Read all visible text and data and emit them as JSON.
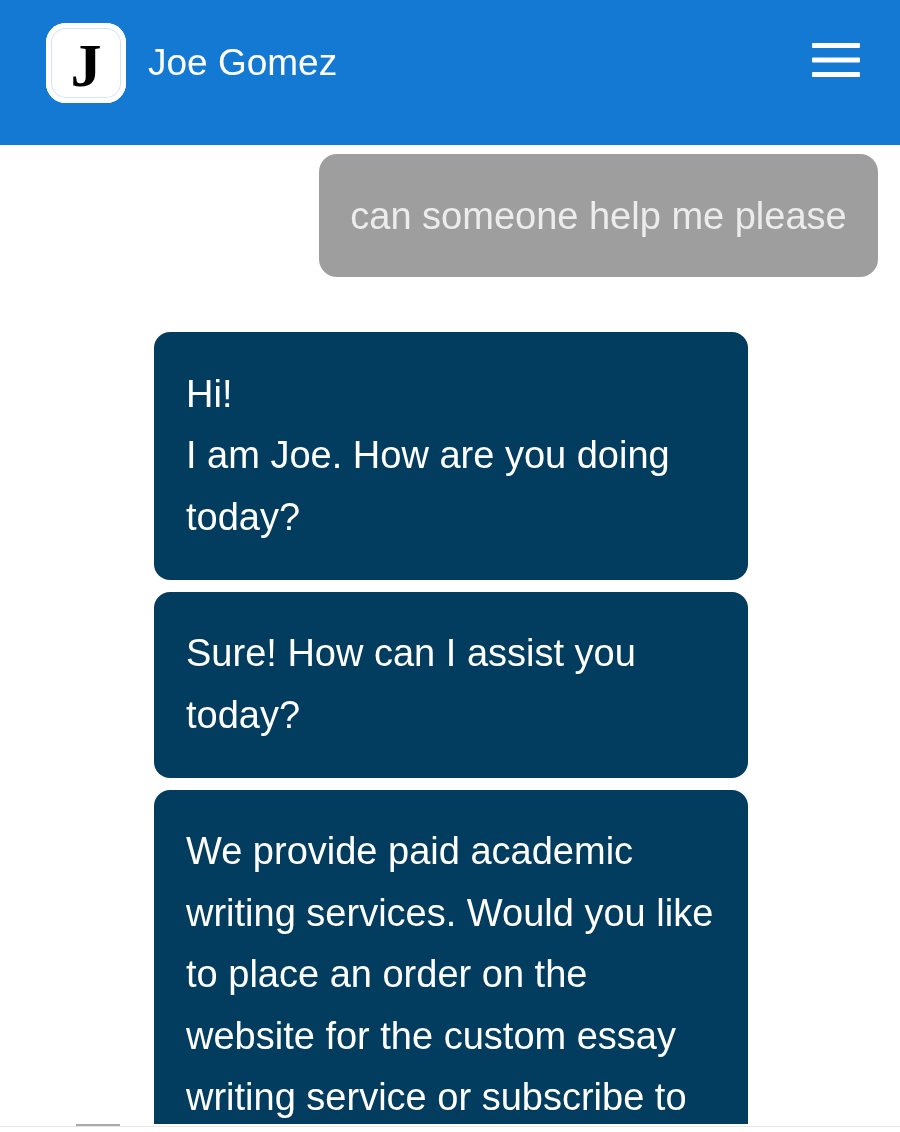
{
  "header": {
    "logo_letter": "J",
    "name": "Joe Gomez"
  },
  "messages": [
    {
      "kind": "user",
      "text": "can someone help me please"
    },
    {
      "kind": "agent",
      "text": "Hi!\nI am Joe. How are you doing today?"
    },
    {
      "kind": "agent",
      "text": "Sure! How can I assist you today?"
    },
    {
      "kind": "agent",
      "text": "We provide paid academic writing services. Would you like to place an order on the website for the custom essay writing service or subscribe to"
    }
  ]
}
